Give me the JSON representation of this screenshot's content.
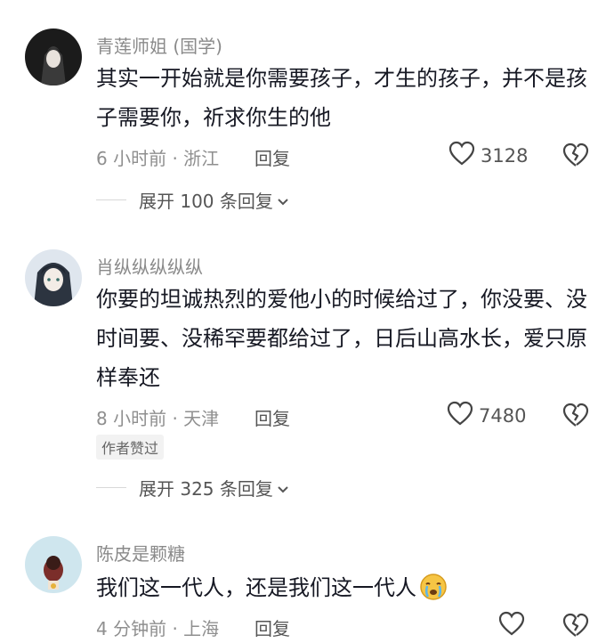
{
  "comments": [
    {
      "username": "青莲师姐 (国学)",
      "text": "其实一开始就是你需要孩子，才生的孩子，并不是孩子需要你，祈求你生的他",
      "time": "6 小时前 · 浙江",
      "reply_label": "回复",
      "likes": "3128",
      "expand_label": "展开 100 条回复"
    },
    {
      "username": "肖纵纵纵纵纵",
      "text": "你要的坦诚热烈的爱他小的时候给过了，你没要、没时间要、没稀罕要都给过了，日后山高水长，爱只原样奉还",
      "time": "8 小时前 · 天津",
      "reply_label": "回复",
      "likes": "7480",
      "badge": "作者赞过",
      "expand_label": "展开 325 条回复"
    },
    {
      "username": "陈皮是颗糖",
      "text": "我们这一代人，还是我们这一代人",
      "time": "4 分钟前 · 上海",
      "reply_label": "回复",
      "likes": ""
    }
  ],
  "colors": {
    "text_primary": "#161823",
    "text_secondary": "#8a8a8a",
    "divider": "#d8d8d8"
  },
  "icons": [
    "heart-outline-icon",
    "broken-heart-icon",
    "chevron-down-icon",
    "crying-emoji-icon"
  ]
}
